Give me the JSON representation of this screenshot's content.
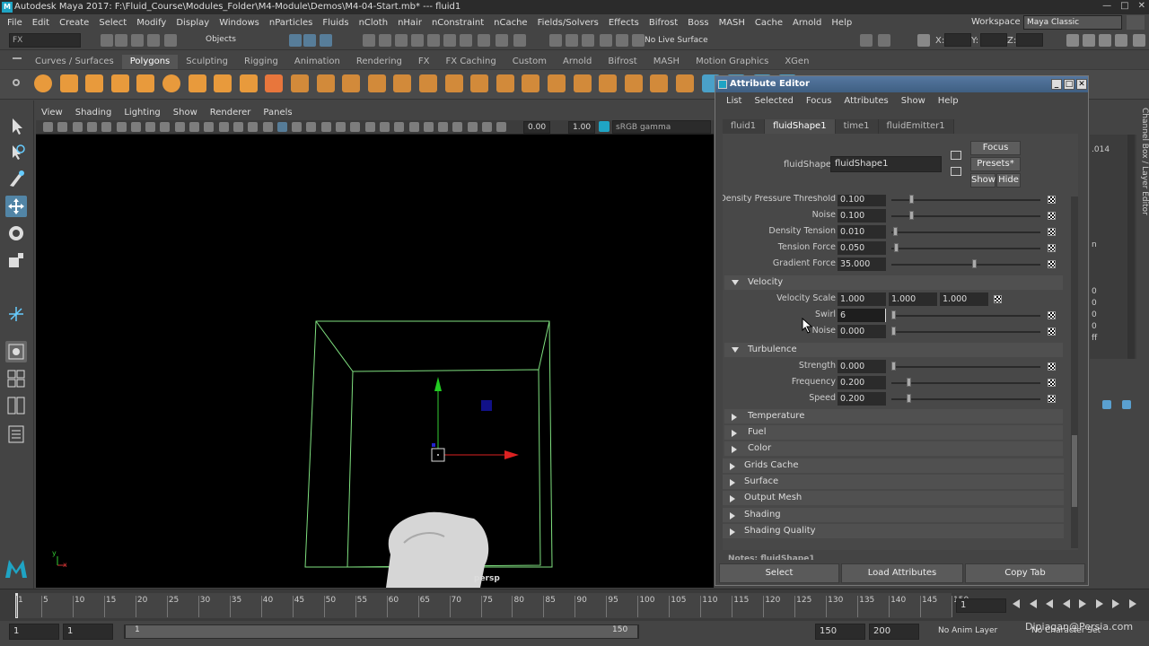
{
  "window": {
    "title": "Autodesk Maya 2017: F:\\Fluid_Course\\Modules_Folder\\M4-Module\\Demos\\M4-04-Start.mb*  ---  fluid1"
  },
  "menubar": [
    "File",
    "Edit",
    "Create",
    "Select",
    "Modify",
    "Display",
    "Windows",
    "nParticles",
    "Fluids",
    "nCloth",
    "nHair",
    "nConstraint",
    "nCache",
    "Fields/Solvers",
    "Effects",
    "Bifrost",
    "Boss",
    "MASH",
    "Cache",
    "Arnold",
    "Help"
  ],
  "workspace": {
    "label": "Workspace :",
    "value": "Maya Classic"
  },
  "status": {
    "mode": "FX",
    "select_mode": "Objects",
    "live_surface": "No Live Surface",
    "x_label": "X:",
    "y_label": "Y:",
    "z_label": "Z:"
  },
  "shelf_tabs": [
    "Curves / Surfaces",
    "Polygons",
    "Sculpting",
    "Rigging",
    "Animation",
    "Rendering",
    "FX",
    "FX Caching",
    "Custom",
    "Arnold",
    "Bifrost",
    "MASH",
    "Motion Graphics",
    "XGen"
  ],
  "active_shelf": "Polygons",
  "viewport": {
    "menu": [
      "View",
      "Shading",
      "Lighting",
      "Show",
      "Renderer",
      "Panels"
    ],
    "exposure": "0.00",
    "gamma": "1.00",
    "color_space": "sRGB gamma",
    "camera_label": "persp",
    "axis_x": "x",
    "axis_y": "y"
  },
  "attribute_editor": {
    "title": "Attribute Editor",
    "menu": [
      "List",
      "Selected",
      "Focus",
      "Attributes",
      "Show",
      "Help"
    ],
    "tabs": [
      "fluid1",
      "fluidShape1",
      "time1",
      "fluidEmitter1"
    ],
    "active_tab": "fluidShape1",
    "node_label": "fluidShape:",
    "node_value": "fluidShape1",
    "focus_btn": "Focus",
    "presets_btn": "Presets*",
    "show_btn": "Show",
    "hide_btn": "Hide",
    "density_rows": [
      {
        "label": "Density Pressure Threshold",
        "value": "0.100",
        "level": 0.12
      },
      {
        "label": "Noise",
        "value": "0.100",
        "level": 0.12
      },
      {
        "label": "Density Tension",
        "value": "0.010",
        "level": 0.01
      },
      {
        "label": "Tension Force",
        "value": "0.050",
        "level": 0.02
      },
      {
        "label": "Gradient Force",
        "value": "35.000",
        "level": 0.54
      }
    ],
    "velocity_section": "Velocity",
    "velocity_scale": {
      "label": "Velocity Scale",
      "x": "1.000",
      "y": "1.000",
      "z": "1.000"
    },
    "velocity_rows": [
      {
        "label": "Swirl",
        "value": "6",
        "level": 0.0
      },
      {
        "label": "Noise",
        "value": "0.000",
        "level": 0.0
      }
    ],
    "turbulence_section": "Turbulence",
    "turbulence_rows": [
      {
        "label": "Strength",
        "value": "0.000",
        "level": 0.0
      },
      {
        "label": "Frequency",
        "value": "0.200",
        "level": 0.1
      },
      {
        "label": "Speed",
        "value": "0.200",
        "level": 0.1
      }
    ],
    "collapsed_sub": [
      "Temperature",
      "Fuel",
      "Color"
    ],
    "collapsed_main": [
      "Grids Cache",
      "Surface",
      "Output Mesh",
      "Shading",
      "Shading Quality"
    ],
    "notes_label": "Notes:  fluidShape1",
    "bottom_buttons": [
      "Select",
      "Load Attributes",
      "Copy Tab"
    ]
  },
  "channel_box": {
    "side_label": "Channel Box / Layer Editor",
    "values": [
      ".014",
      "n",
      "0",
      "0",
      "0",
      "0",
      "ff"
    ]
  },
  "timeline": {
    "ticks": [
      "1",
      "5",
      "10",
      "15",
      "20",
      "25",
      "30",
      "35",
      "40",
      "45",
      "50",
      "55",
      "60",
      "65",
      "70",
      "75",
      "80",
      "85",
      "90",
      "95",
      "100",
      "105",
      "110",
      "115",
      "120",
      "125",
      "130",
      "135",
      "140",
      "145",
      "150"
    ],
    "current_frame": "1"
  },
  "range": {
    "start": "1",
    "playback_start": "1",
    "slider_start": "1",
    "slider_end": "150",
    "playback_end": "150",
    "end": "200",
    "anim_layer": "No Anim Layer",
    "char_set": "No Character Set"
  },
  "watermark": "Dipiagan@Persia.com"
}
